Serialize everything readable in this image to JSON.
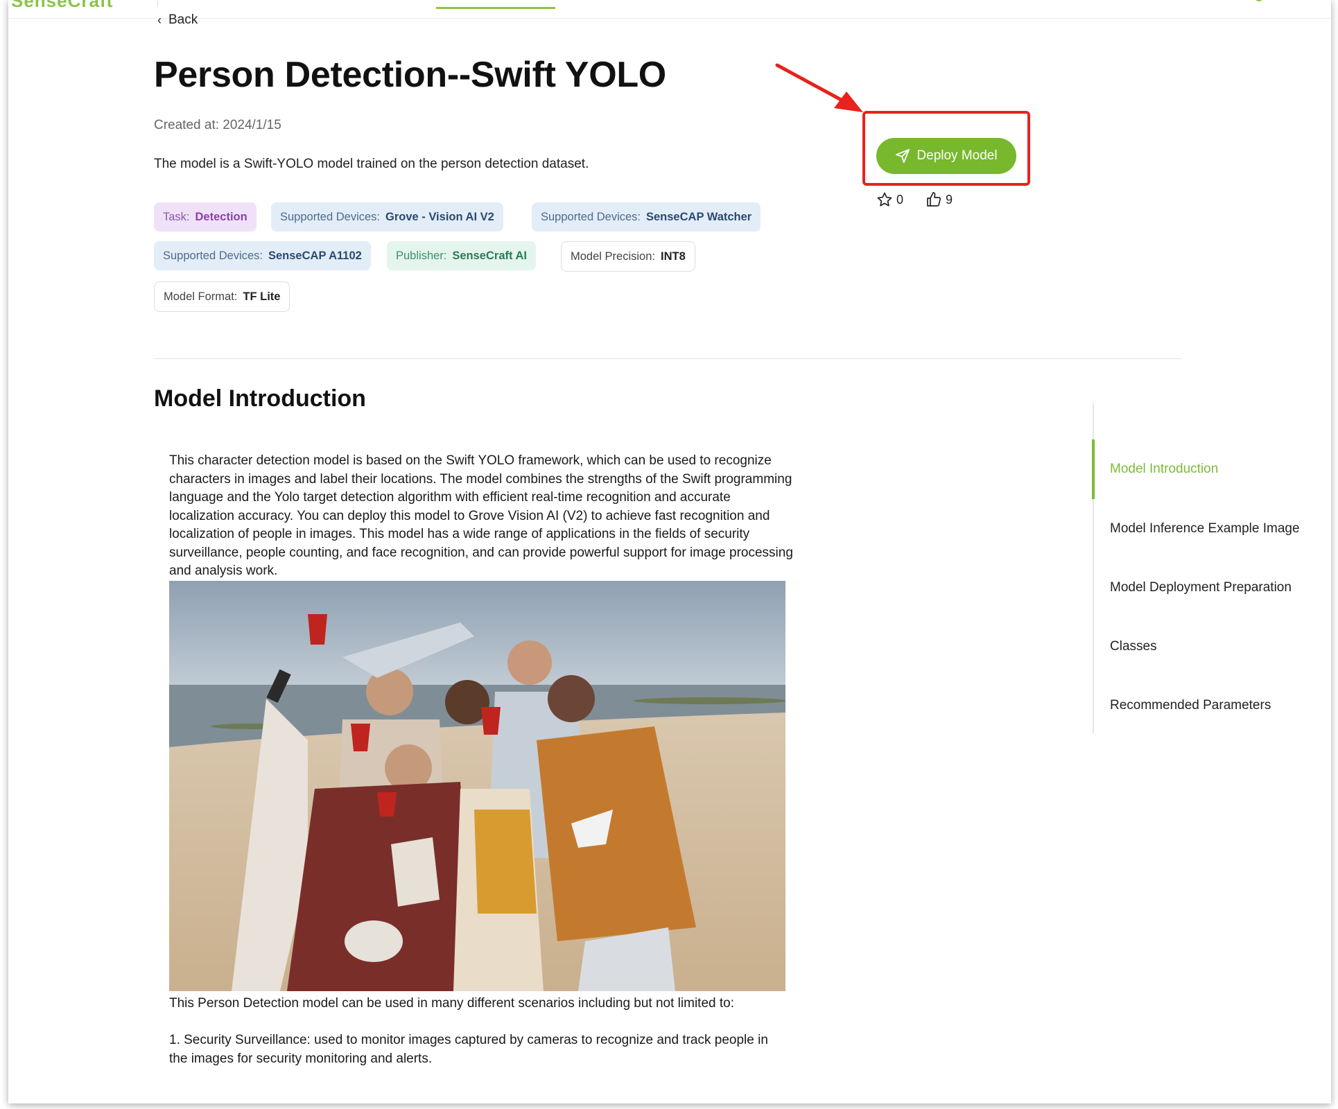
{
  "topbar": {
    "logo_text": "SenseCraft"
  },
  "nav": {
    "back_label": "Back"
  },
  "model": {
    "title": "Person Detection--Swift YOLO",
    "created": "Created at: 2024/1/15",
    "description": "The model is a Swift-YOLO model trained on the person detection dataset."
  },
  "tags": [
    {
      "key": "Task:",
      "value": "Detection"
    },
    {
      "key": "Supported Devices:",
      "value": "Grove - Vision AI V2"
    },
    {
      "key": "Supported Devices:",
      "value": "SenseCAP Watcher"
    },
    {
      "key": "Supported Devices:",
      "value": "SenseCAP A1102"
    },
    {
      "key": "Publisher:",
      "value": "SenseCraft AI"
    },
    {
      "key": "Model Precision:",
      "value": "INT8"
    },
    {
      "key": "Model Format:",
      "value": "TF Lite"
    }
  ],
  "actions": {
    "deploy_label": "Deploy Model",
    "favorites": "0",
    "likes": "9"
  },
  "section": {
    "title": "Model Introduction"
  },
  "intro": {
    "paragraph": "This character detection model is based on the Swift YOLO framework, which can be used to recognize characters in images and label their locations. The model combines the strengths of the Swift programming language and the Yolo target detection algorithm with efficient real-time recognition and accurate localization accuracy. You can deploy this model to Grove Vision AI (V2) to achieve fast recognition and localization of people in images. This model has a wide range of applications in the fields of security surveillance, people counting, and face recognition, and can provide powerful support for image processing and analysis work.",
    "usage": "This Person Detection model can be used in many different scenarios including but not limited to:",
    "item1": "1. Security Surveillance: used to monitor images captured by cameras to recognize and track people in the images for security monitoring and alerts."
  },
  "toc": [
    {
      "label": "Model Introduction"
    },
    {
      "label": "Model Inference Example Image"
    },
    {
      "label": "Model Deployment Preparation"
    },
    {
      "label": "Classes"
    },
    {
      "label": "Recommended Parameters"
    }
  ],
  "colors": {
    "accent": "#77b82c",
    "highlight": "#e8221c"
  }
}
